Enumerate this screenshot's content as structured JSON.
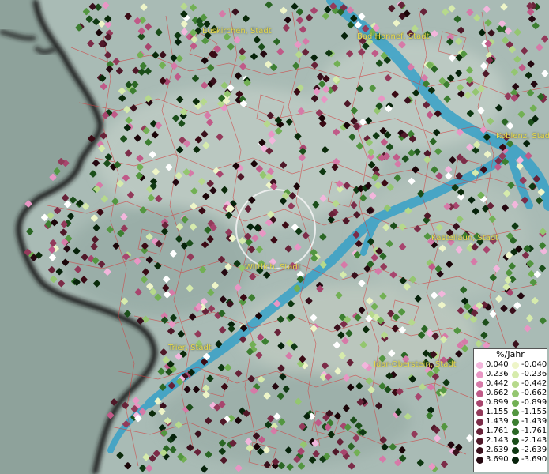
{
  "map": {
    "cities": [
      {
        "id": "euskirchen",
        "label": "Euskirchen, Stadt"
      },
      {
        "id": "bad-honnef",
        "label": "Bad Honnef, Stadt"
      },
      {
        "id": "koblenz",
        "label": "Koblenz, Stadt"
      },
      {
        "id": "kastellaun",
        "label": "Kastellaun, Stadt"
      },
      {
        "id": "wittlich",
        "label": "Wittlich, Stadt"
      },
      {
        "id": "trier",
        "label": "Trier, Stadt"
      },
      {
        "id": "idar-oberstein",
        "label": "Idar-Oberstein, Stadt"
      }
    ],
    "legend": {
      "title": "%/Jahr",
      "positive": [
        {
          "value": "0.040",
          "color": "#f2b6dc"
        },
        {
          "value": "0.236",
          "color": "#e896c4"
        },
        {
          "value": "0.442",
          "color": "#d67aa8"
        },
        {
          "value": "0.662",
          "color": "#c05a88"
        },
        {
          "value": "0.899",
          "color": "#a8456e"
        },
        {
          "value": "1.155",
          "color": "#933a5a"
        },
        {
          "value": "1.439",
          "color": "#7c2c48"
        },
        {
          "value": "1.761",
          "color": "#672238"
        },
        {
          "value": "2.143",
          "color": "#4f1828"
        },
        {
          "value": "2.639",
          "color": "#3a101c"
        },
        {
          "value": "3.690",
          "color": "#240810"
        }
      ],
      "negative": [
        {
          "value": "-0.040",
          "color": "#eef5c8"
        },
        {
          "value": "-0.236",
          "color": "#d6ebac"
        },
        {
          "value": "-0.442",
          "color": "#b6d98c"
        },
        {
          "value": "-0.662",
          "color": "#94c670"
        },
        {
          "value": "-0.899",
          "color": "#72b054"
        },
        {
          "value": "-1.155",
          "color": "#539640"
        },
        {
          "value": "-1.439",
          "color": "#3c7e30"
        },
        {
          "value": "-1.761",
          "color": "#2a6624"
        },
        {
          "value": "-2.143",
          "color": "#1b4e1a"
        },
        {
          "value": "-2.639",
          "color": "#0f3812"
        },
        {
          "value": "-3.690",
          "color": "#06220a"
        }
      ]
    }
  }
}
